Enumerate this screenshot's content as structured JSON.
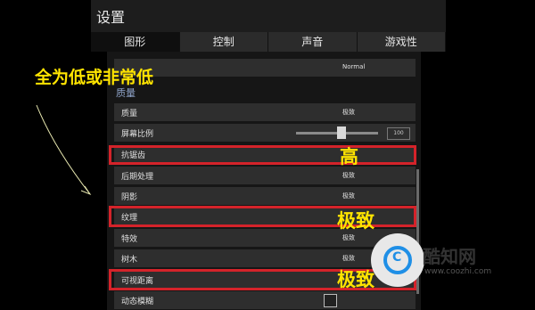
{
  "window": {
    "title": "设置"
  },
  "tabs": [
    {
      "label": "图形"
    },
    {
      "label": "控制"
    },
    {
      "label": "声音"
    },
    {
      "label": "游戏性"
    }
  ],
  "preset_value": "Normal",
  "section_title": "质量",
  "settings": [
    {
      "label": "质量",
      "value": "极致"
    },
    {
      "label": "屏幕比例",
      "value": "100"
    },
    {
      "label": "抗锯齿",
      "value": ""
    },
    {
      "label": "后期处理",
      "value": "极致"
    },
    {
      "label": "阴影",
      "value": "极致"
    },
    {
      "label": "纹理",
      "value": ""
    },
    {
      "label": "特效",
      "value": "极致"
    },
    {
      "label": "树木",
      "value": "极致"
    },
    {
      "label": "可视距离",
      "value": ""
    },
    {
      "label": "动态模糊",
      "value": ""
    }
  ],
  "screen_scale_level": 0.55,
  "annotations": {
    "top_note": "全为低或非常低",
    "anti_aliasing": "高",
    "texture": "极致",
    "view_distance": "极致"
  },
  "watermark": {
    "name": "酷知网",
    "url": "www.coozhi.com",
    "logo": "C"
  },
  "colors": {
    "highlight": "#d4232a",
    "annotation": "#ffe400",
    "section": "#8fa3c8"
  }
}
